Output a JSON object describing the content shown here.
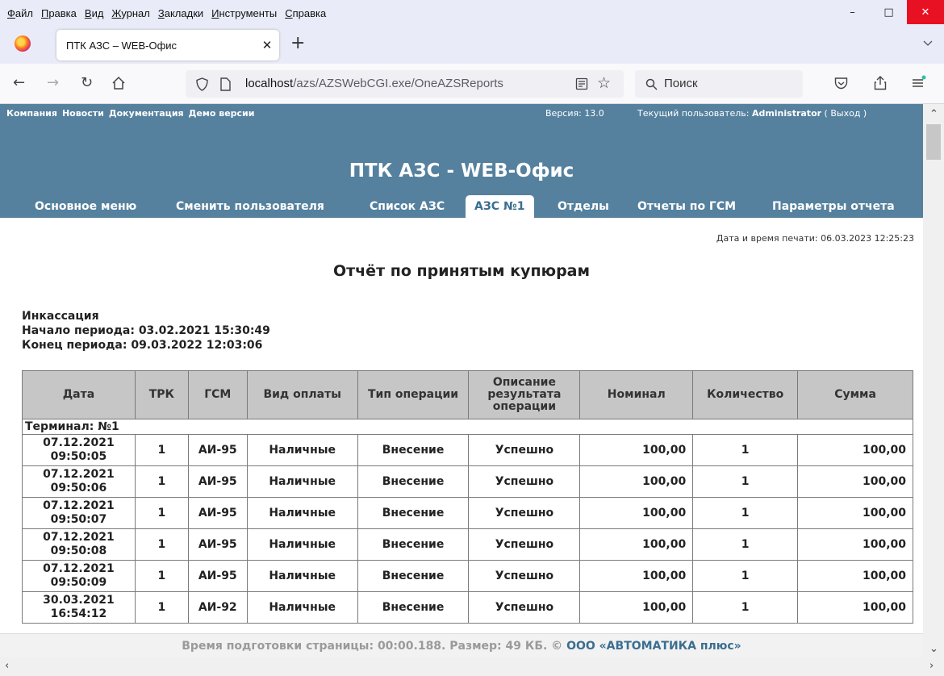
{
  "menubar": {
    "items": [
      {
        "underline": "Ф",
        "rest": "айл"
      },
      {
        "underline": "П",
        "rest": "равка"
      },
      {
        "underline": "В",
        "rest": "ид"
      },
      {
        "underline": "Ж",
        "rest": "урнал"
      },
      {
        "underline": "З",
        "rest": "акладки"
      },
      {
        "underline": "И",
        "rest": "нструменты"
      },
      {
        "underline": "С",
        "rest": "правка"
      }
    ]
  },
  "window_controls": {
    "minimize": "–",
    "maximize": "□",
    "close": "✕"
  },
  "tab": {
    "title": "ПТК АЗС – WEB-Офис",
    "close": "✕",
    "new_tab": "+"
  },
  "url": {
    "host": "localhost",
    "path": "/azs/AZSWebCGI.exe/OneAZSReports"
  },
  "search": {
    "placeholder": "Поиск"
  },
  "site": {
    "top_links": [
      "Компания",
      "Новости",
      "Документация",
      "Демо версии"
    ],
    "version": "Версия: 13.0",
    "user_prefix": "Текущий пользователь: ",
    "user_name": "Administrator",
    "logout": " ( Выход )",
    "title": "ПТК АЗС - WEB-Офис",
    "nav_tabs": [
      "Основное меню",
      "Сменить пользователя",
      "Список АЗС",
      "АЗС №1",
      "Отделы",
      "Отчеты по ГСМ",
      "Параметры отчета"
    ],
    "active_tab": "АЗС №1"
  },
  "report": {
    "print_date": "Дата и время печати: 06.03.2023 12:25:23",
    "title": "Отчёт по принятым купюрам",
    "meta_1": "Инкассация",
    "meta_2": "Начало периода: 03.02.2021 15:30:49",
    "meta_3": "Конец периода: 09.03.2022 12:03:06",
    "columns": [
      "Дата",
      "ТРК",
      "ГСМ",
      "Вид оплаты",
      "Тип операции",
      "Описание результата операции",
      "Номинал",
      "Количество",
      "Сумма"
    ],
    "terminal": "Терминал: №1",
    "rows": [
      {
        "date": "07.12.2021",
        "time": "09:50:05",
        "trk": "1",
        "fuel": "АИ-95",
        "payment": "Наличные",
        "operation": "Внесение",
        "result": "Успешно",
        "nominal": "100,00",
        "qty": "1",
        "sum": "100,00"
      },
      {
        "date": "07.12.2021",
        "time": "09:50:06",
        "trk": "1",
        "fuel": "АИ-95",
        "payment": "Наличные",
        "operation": "Внесение",
        "result": "Успешно",
        "nominal": "100,00",
        "qty": "1",
        "sum": "100,00"
      },
      {
        "date": "07.12.2021",
        "time": "09:50:07",
        "trk": "1",
        "fuel": "АИ-95",
        "payment": "Наличные",
        "operation": "Внесение",
        "result": "Успешно",
        "nominal": "100,00",
        "qty": "1",
        "sum": "100,00"
      },
      {
        "date": "07.12.2021",
        "time": "09:50:08",
        "trk": "1",
        "fuel": "АИ-95",
        "payment": "Наличные",
        "operation": "Внесение",
        "result": "Успешно",
        "nominal": "100,00",
        "qty": "1",
        "sum": "100,00"
      },
      {
        "date": "07.12.2021",
        "time": "09:50:09",
        "trk": "1",
        "fuel": "АИ-95",
        "payment": "Наличные",
        "operation": "Внесение",
        "result": "Успешно",
        "nominal": "100,00",
        "qty": "1",
        "sum": "100,00"
      },
      {
        "date": "30.03.2021",
        "time": "16:54:12",
        "trk": "1",
        "fuel": "АИ-92",
        "payment": "Наличные",
        "operation": "Внесение",
        "result": "Успешно",
        "nominal": "100,00",
        "qty": "1",
        "sum": "100,00"
      }
    ]
  },
  "footer": {
    "text": "Время подготовки страницы: 00:00.188. Размер: 49 КБ. © ",
    "company": "ООО «АВТОМАТИКА плюс»"
  },
  "colors": {
    "header_bg": "#55819e",
    "close_red": "#e81123",
    "table_header": "#c6c6c6"
  },
  "icons": [
    "firefox-logo-icon",
    "back-icon",
    "forward-icon",
    "reload-icon",
    "home-icon",
    "shield-icon",
    "page-icon",
    "reader-view-icon",
    "bookmark-star-icon",
    "search-icon",
    "pocket-icon",
    "share-icon",
    "menu-icon",
    "tabs-list-chevron-icon"
  ]
}
